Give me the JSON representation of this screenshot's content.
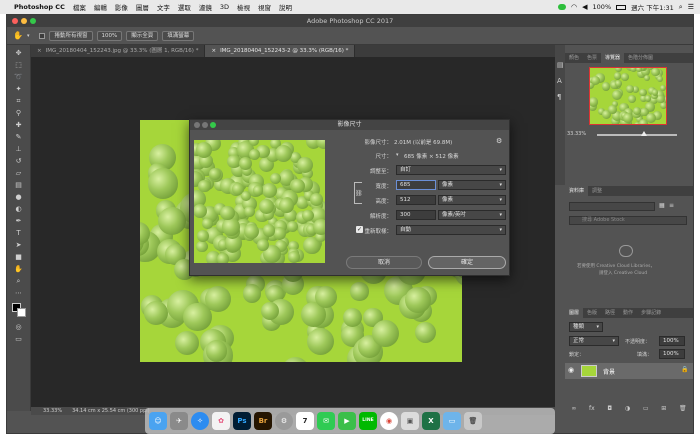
{
  "menubar": {
    "apple": "",
    "app": "Photoshop CC",
    "items": [
      "檔案",
      "編輯",
      "影像",
      "圖層",
      "文字",
      "選取",
      "濾鏡",
      "3D",
      "檢視",
      "視窗",
      "說明"
    ],
    "status_right": [
      "100%",
      "週六 下午1:31"
    ]
  },
  "window": {
    "title": "Adobe Photoshop CC 2017"
  },
  "options_bar": {
    "scroll_all": "捲動所有視窗",
    "zoom_100": "100%",
    "fit_screen": "顯示全頁",
    "fill_screen": "填滿螢幕"
  },
  "tabs": [
    {
      "label": "IMG_20180404_152243.jpg @ 33.3% (圖層 1, RGB/16) *",
      "active": false
    },
    {
      "label": "IMG_20180404_152243-2 @ 33.3% (RGB/16) *",
      "active": true
    }
  ],
  "status": {
    "zoom": "33.33%",
    "doc_size": "34.14 cm x 25.54 cm (300 ppi)"
  },
  "panels": {
    "top_tabs": [
      "顏色",
      "色票",
      "導覽器",
      "色階分佈圖"
    ],
    "navigator_zoom": "33.33%",
    "library_tabs": [
      "資料庫",
      "調整"
    ],
    "library_search": "搜尋 Adobe Stock",
    "library_msg1": "若要使用 Creative Cloud Libraries，",
    "library_msg2": "請登入 Creative Cloud",
    "layers_tabs": [
      "圖層",
      "色版",
      "路徑",
      "動作",
      "步驟記錄"
    ],
    "layer_kind": "種類",
    "blend_mode": "正常",
    "opacity_label": "不透明度：",
    "opacity": "100%",
    "fill_label": "填滿：",
    "fill": "100%",
    "lock_label": "鎖定：",
    "layer_name": "背景"
  },
  "dialog": {
    "title": "影像尺寸",
    "image_size_label": "影像尺寸：",
    "image_size_value": "2.01M (以前是 69.8M)",
    "dimensions_label": "尺寸：",
    "dimensions_value": "685 像素 × 512 像素",
    "fit_label": "調整至：",
    "fit_value": "自訂",
    "width_label": "寬度：",
    "width_value": "685",
    "width_unit": "像素",
    "height_label": "高度：",
    "height_value": "512",
    "height_unit": "像素",
    "resolution_label": "解析度：",
    "resolution_value": "300",
    "resolution_unit": "像素/英吋",
    "resample_label": "重新取樣：",
    "resample_value": "自動",
    "cancel": "取消",
    "ok": "確定"
  },
  "dock": {
    "icons": [
      "finder-icon",
      "launchpad-icon",
      "safari-icon",
      "photos-icon",
      "photoshop-icon",
      "bridge-icon",
      "system-prefs-icon",
      "calendar-icon",
      "messages-icon",
      "facetime-icon",
      "line-icon",
      "chrome-icon",
      "preview-icon",
      "excel-icon",
      "folder-icon",
      "trash-icon"
    ],
    "labels": {
      "photoshop": "Ps",
      "bridge": "Br",
      "excel": "X",
      "line": "LINE",
      "calendar": "7"
    }
  }
}
